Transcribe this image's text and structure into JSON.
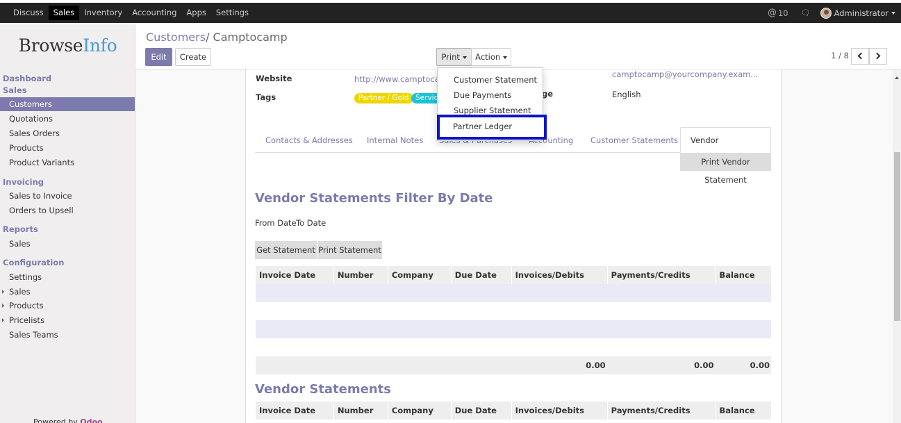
{
  "topbar": {
    "menu": [
      "Discuss",
      "Sales",
      "Inventory",
      "Accounting",
      "Apps",
      "Settings"
    ],
    "active_menu": "Sales",
    "activity_count": "10",
    "user": "Administrator"
  },
  "sidebar": {
    "logo_a": "Browse",
    "logo_b": "Info",
    "dashboard": "Dashboard",
    "sales_section": "Sales",
    "sales_items": [
      "Customers",
      "Quotations",
      "Sales Orders",
      "Products",
      "Product Variants"
    ],
    "invoicing_section": "Invoicing",
    "invoicing_items": [
      "Sales to Invoice",
      "Orders to Upsell"
    ],
    "reports_section": "Reports",
    "reports_items": [
      "Sales"
    ],
    "configuration_section": "Configuration",
    "configuration_items": [
      "Settings",
      "Sales",
      "Products",
      "Pricelists",
      "Sales Teams"
    ],
    "powered_by": "Powered by",
    "powered_brand": "Odoo"
  },
  "control_panel": {
    "breadcrumb_parent": "Customers",
    "breadcrumb_sep": "/",
    "breadcrumb_current": "Camptocamp",
    "edit_label": "Edit",
    "create_label": "Create",
    "print_label": "Print",
    "action_label": "Action",
    "pager": "1 / 8"
  },
  "print_menu": {
    "items": [
      "Customer Statement",
      "Due Payments",
      "Supplier Statement",
      "Partner Ledger"
    ],
    "highlighted": "Partner Ledger"
  },
  "form": {
    "website_label": "Website",
    "website_value": "http://www.camptocam",
    "email_value": "camptocamp@yourcompany.exam...",
    "tags_label": "Tags",
    "tags": [
      "Partner / Gold",
      "Servic"
    ],
    "language_label_partial": "ge",
    "language_value": "English"
  },
  "tabs": [
    "Contacts & Addresses",
    "Internal Notes",
    "Sales & Purchases",
    "Accounting",
    "Customer Statements",
    "Vendor Statements"
  ],
  "active_tab": "Vendor Statements",
  "vendor": {
    "print_vendor_statement": "Print Vendor Statement",
    "filter_title": "Vendor Statements Filter By Date",
    "from_date": "From Date",
    "to_date": "To Date",
    "get_statement": "Get Statement",
    "print_statement": "Print Statement",
    "columns": [
      "Invoice Date",
      "Number",
      "Company",
      "Due Date",
      "Invoices/Debits",
      "Payments/Credits",
      "Balance"
    ],
    "totals": [
      "0.00",
      "0.00",
      "0.00"
    ],
    "statements_title": "Vendor Statements"
  },
  "colors": {
    "accent": "#7c7bad",
    "highlight_border": "#0a14c8",
    "tag_gold": "#f0d600",
    "tag_service": "#1cc3d8"
  }
}
